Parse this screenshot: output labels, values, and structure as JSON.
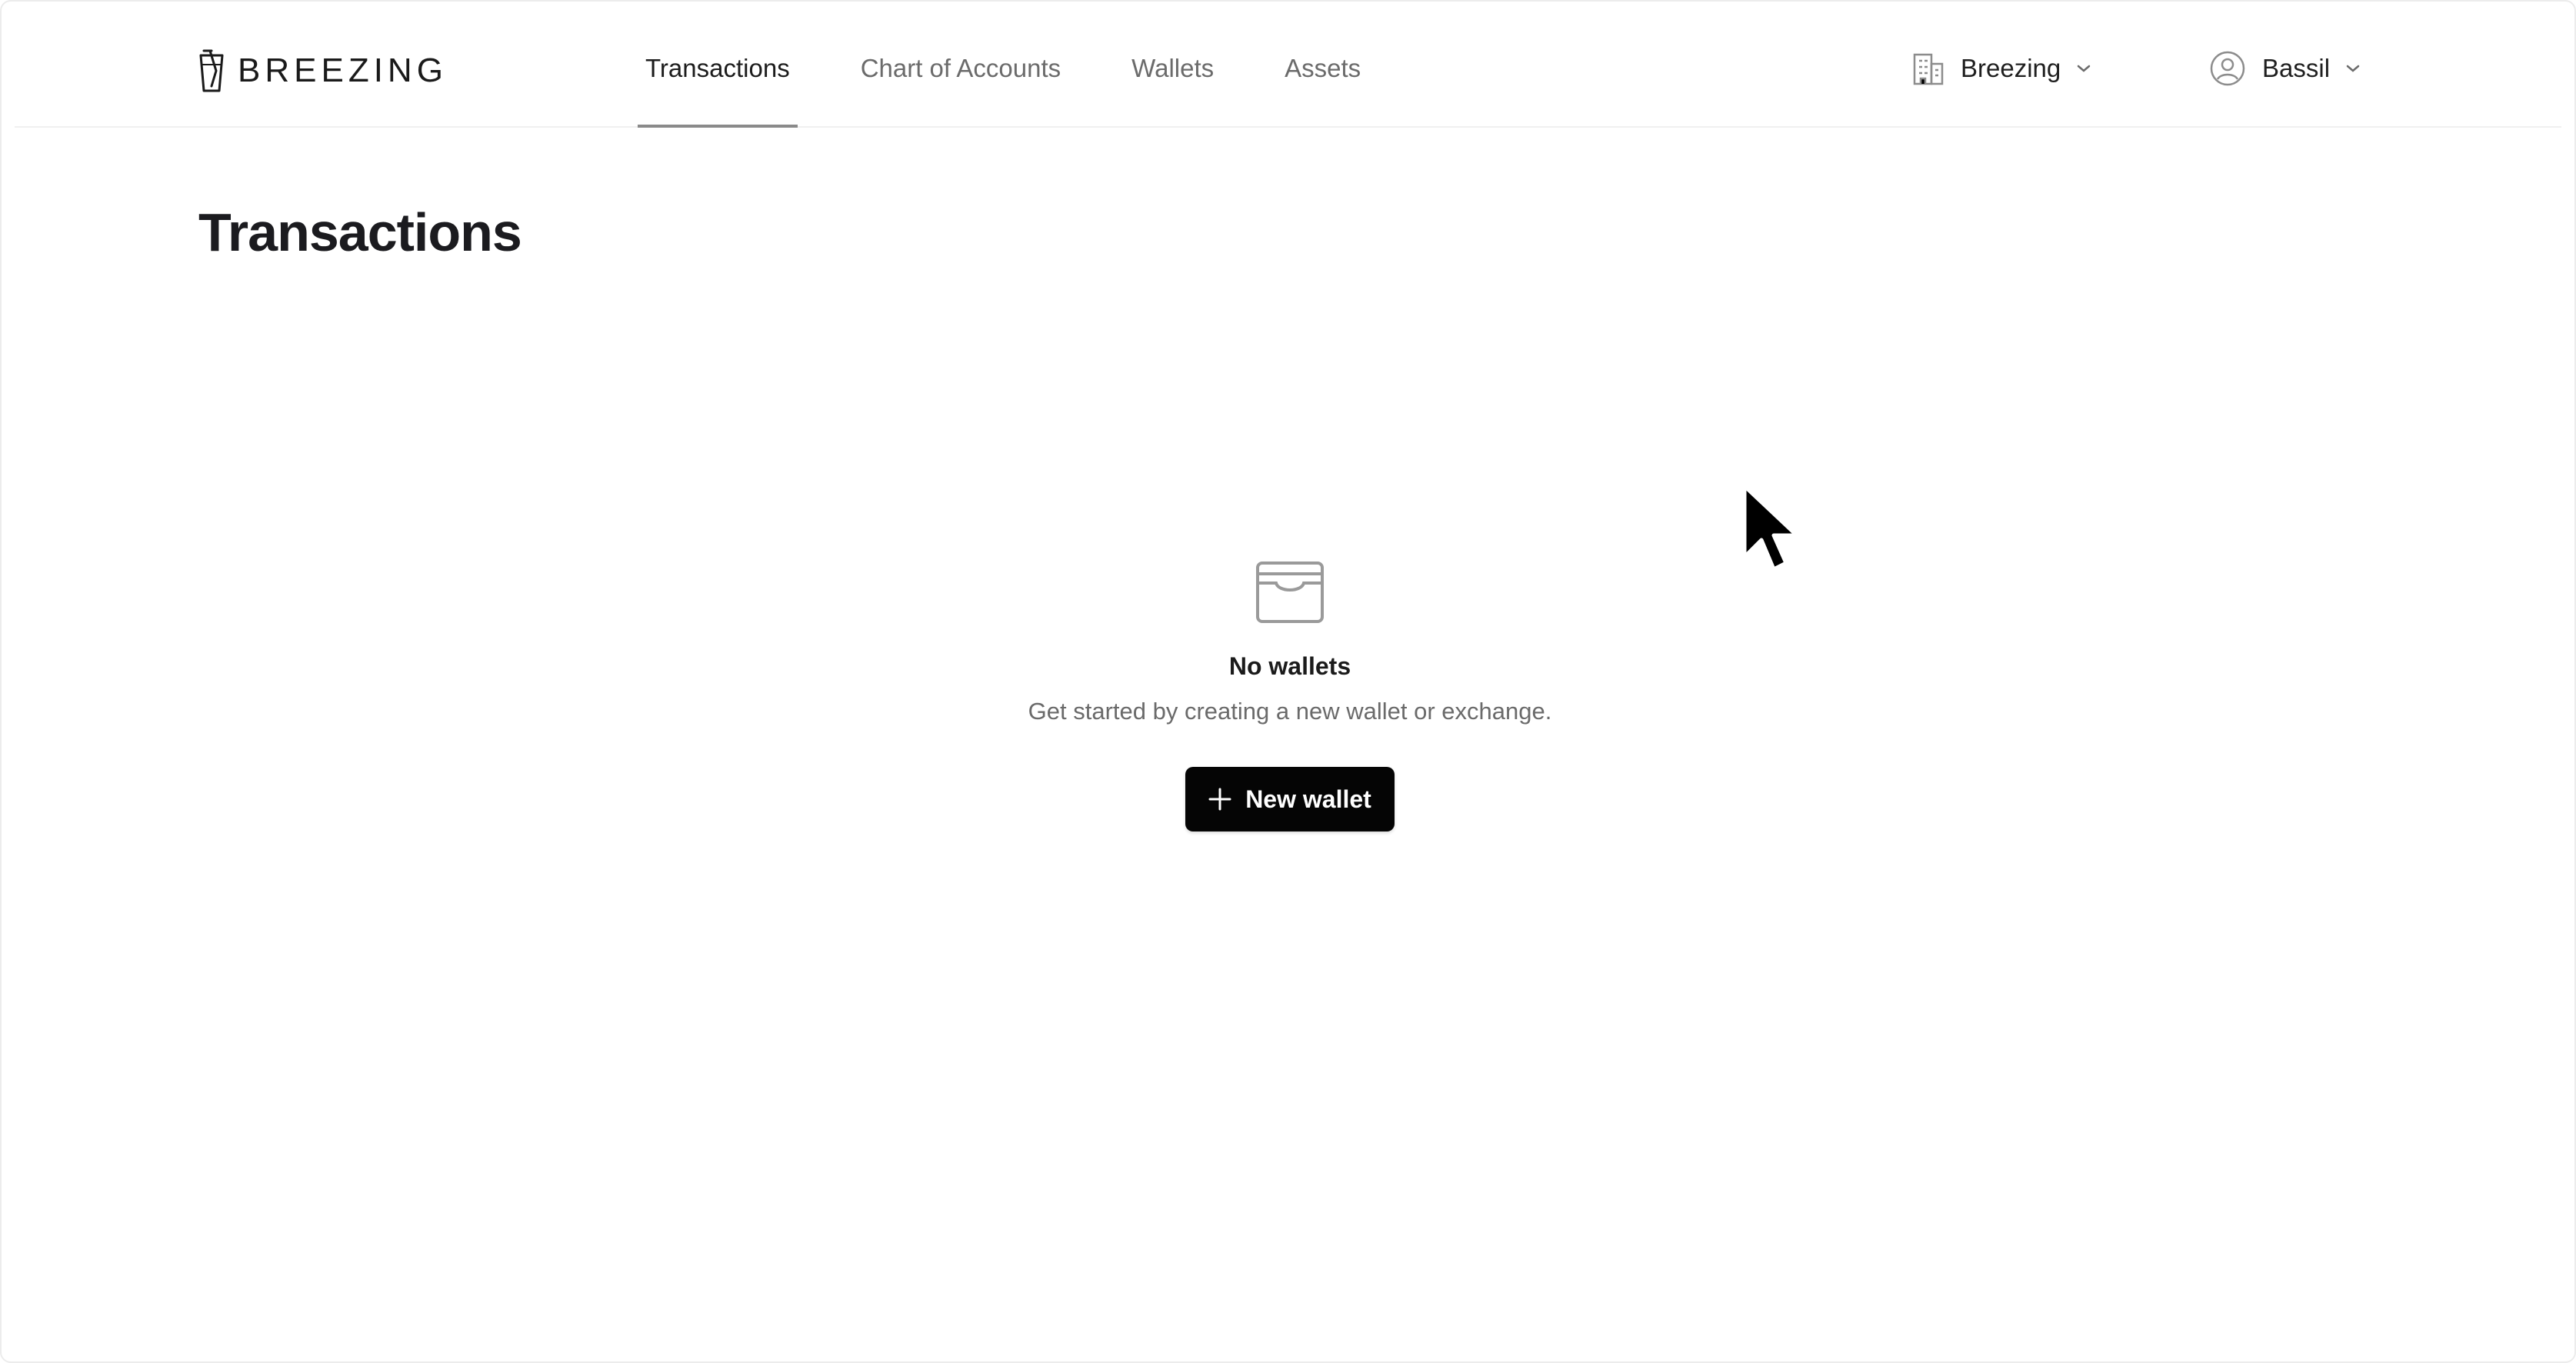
{
  "brand": {
    "name": "BREEZING",
    "logo_icon": "breezing-glass-logo"
  },
  "nav": {
    "items": [
      {
        "label": "Transactions",
        "active": true
      },
      {
        "label": "Chart of Accounts",
        "active": false
      },
      {
        "label": "Wallets",
        "active": false
      },
      {
        "label": "Assets",
        "active": false
      }
    ]
  },
  "header": {
    "org_label": "Breezing",
    "org_icon": "building-icon",
    "user_label": "Bassil",
    "user_icon": "user-circle-icon",
    "chevron_icon": "chevron-down-icon"
  },
  "page": {
    "title": "Transactions"
  },
  "empty_state": {
    "icon": "wallet-icon",
    "title": "No wallets",
    "description": "Get started by creating a new wallet or exchange.",
    "button_label": "New wallet",
    "button_icon": "plus-icon"
  },
  "colors": {
    "button_bg": "#050505",
    "active_nav": "#1c1c1c",
    "inactive_nav": "#6b6b6b"
  }
}
